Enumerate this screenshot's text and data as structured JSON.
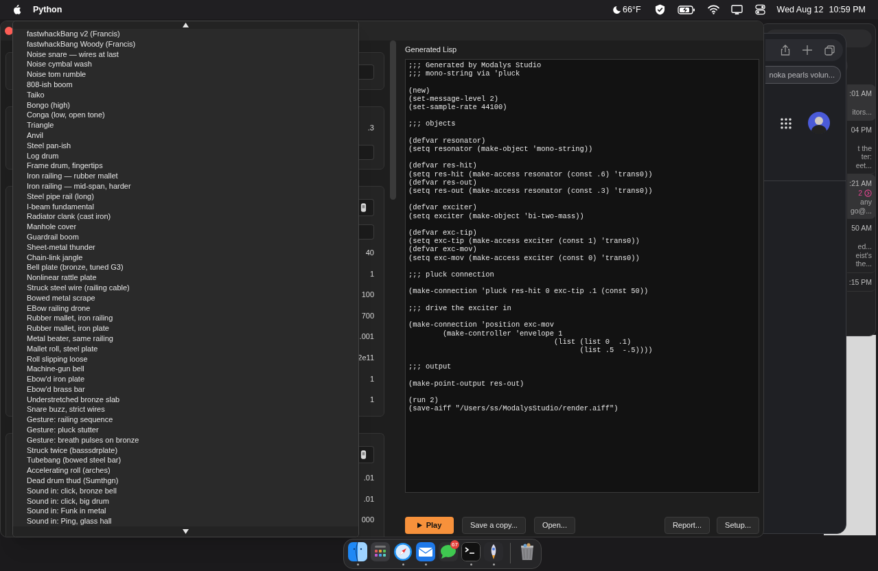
{
  "menu_bar": {
    "app_name": "Python",
    "weather": "66°F",
    "date": "Wed Aug 12",
    "time": "10:59 PM"
  },
  "preset_menu": {
    "items": [
      {
        "label": "fastwhackBang v2 (Francis)",
        "selected": false
      },
      {
        "label": "fastwhackBang Woody (Francis)",
        "selected": false
      },
      {
        "label": "Noise snare — wires at last",
        "selected": false
      },
      {
        "label": "Noise cymbal wash",
        "selected": false
      },
      {
        "label": "Noise tom rumble",
        "selected": false
      },
      {
        "label": "808-ish boom",
        "selected": false
      },
      {
        "label": "Taiko",
        "selected": false
      },
      {
        "label": "Bongo (high)",
        "selected": false
      },
      {
        "label": "Conga (low, open tone)",
        "selected": false
      },
      {
        "label": "Triangle",
        "selected": false
      },
      {
        "label": "Anvil",
        "selected": false
      },
      {
        "label": "Steel pan-ish",
        "selected": false
      },
      {
        "label": "Log drum",
        "selected": false
      },
      {
        "label": "Frame drum, fingertips",
        "selected": false
      },
      {
        "label": "Iron railing — rubber mallet",
        "selected": false
      },
      {
        "label": "Iron railing — mid-span, harder",
        "selected": false
      },
      {
        "label": "Steel pipe rail (long)",
        "selected": false
      },
      {
        "label": "I-beam fundamental",
        "selected": false
      },
      {
        "label": "Radiator clank (cast iron)",
        "selected": false
      },
      {
        "label": "Manhole cover",
        "selected": false
      },
      {
        "label": "Guardrail boom",
        "selected": false
      },
      {
        "label": "Sheet-metal thunder",
        "selected": false
      },
      {
        "label": "Chain-link jangle",
        "selected": false
      },
      {
        "label": "Bell plate (bronze, tuned G3)",
        "selected": false
      },
      {
        "label": "Nonlinear rattle plate",
        "selected": false
      },
      {
        "label": "Struck steel wire (railing cable)",
        "selected": false
      },
      {
        "label": "Bowed metal scrape",
        "selected": false
      },
      {
        "label": "EBow railing drone",
        "selected": false
      },
      {
        "label": "Rubber mallet, iron railing",
        "selected": false
      },
      {
        "label": "Rubber mallet, iron plate",
        "selected": false
      },
      {
        "label": "Metal beater, same railing",
        "selected": false
      },
      {
        "label": "Mallet roll, steel plate",
        "selected": false
      },
      {
        "label": "Roll slipping loose",
        "selected": false
      },
      {
        "label": "Machine-gun bell",
        "selected": false
      },
      {
        "label": "Ebow'd iron plate",
        "selected": false
      },
      {
        "label": "Ebow'd brass bar",
        "selected": false
      },
      {
        "label": "Understretched bronze slab",
        "selected": false
      },
      {
        "label": "Snare buzz, strict wires",
        "selected": false
      },
      {
        "label": "Gesture: railing sequence",
        "selected": false
      },
      {
        "label": "Gesture: pluck stutter",
        "selected": false
      },
      {
        "label": "Gesture: breath pulses on bronze",
        "selected": false
      },
      {
        "label": "Struck twice (basssdrplate)",
        "selected": false
      },
      {
        "label": "Tubebang (bowed steel bar)",
        "selected": false
      },
      {
        "label": "Accelerating roll (arches)",
        "selected": false
      },
      {
        "label": "Dead drum thud (Sumthgn)",
        "selected": false
      },
      {
        "label": "Sound in: click, bronze bell",
        "selected": false
      },
      {
        "label": "Sound in: click, big drum",
        "selected": false
      },
      {
        "label": "Sound in: Funk in metal",
        "selected": false
      },
      {
        "label": "Sound in: Ping, glass hall",
        "selected": false
      }
    ]
  },
  "parameter_panels": [
    {
      "rows": [
        {
          "kind": "field"
        }
      ]
    },
    {
      "rows": [
        {
          "kind": "value",
          "value": ".3"
        },
        {
          "kind": "field"
        }
      ]
    },
    {
      "rows": [
        {
          "kind": "icon_field"
        },
        {
          "kind": "field"
        },
        {
          "kind": "value",
          "value": "40"
        },
        {
          "kind": "value",
          "value": "1"
        },
        {
          "kind": "value",
          "value": "100"
        },
        {
          "kind": "value",
          "value": "700"
        },
        {
          "kind": "value",
          "value": ".001"
        },
        {
          "kind": "value",
          "value": "2e11"
        },
        {
          "kind": "value",
          "value": "1"
        },
        {
          "kind": "value",
          "value": "1"
        }
      ]
    },
    {
      "rows": [
        {
          "kind": "icon_field"
        },
        {
          "kind": "value",
          "value": ".01"
        },
        {
          "kind": "value",
          "value": ".01"
        },
        {
          "kind": "value",
          "value": "000"
        }
      ]
    }
  ],
  "lisp_panel": {
    "title": "Generated Lisp",
    "code": ";;; Generated by Modalys Studio\n;;; mono-string via 'pluck\n\n(new)\n(set-message-level 2)\n(set-sample-rate 44100)\n\n;;; objects\n\n(defvar resonator)\n(setq resonator (make-object 'mono-string))\n\n(defvar res-hit)\n(setq res-hit (make-access resonator (const .6) 'trans0))\n(defvar res-out)\n(setq res-out (make-access resonator (const .3) 'trans0))\n\n(defvar exciter)\n(setq exciter (make-object 'bi-two-mass))\n\n(defvar exc-tip)\n(setq exc-tip (make-access exciter (const 1) 'trans0))\n(defvar exc-mov)\n(setq exc-mov (make-access exciter (const 0) 'trans0))\n\n;;; pluck connection\n\n(make-connection 'pluck res-hit 0 exc-tip .1 (const 50))\n\n;;; drive the exciter in\n\n(make-connection 'position exc-mov\n        (make-controller 'envelope 1\n                                  (list (list 0  .1)\n                                        (list .5  -.5))))\n\n;;; output\n\n(make-point-output res-out)\n\n(run 2)\n(save-aiff \"/Users/ss/ModalysStudio/render.aiff\")"
  },
  "left_buttons": [
    {
      "label": "Play",
      "kind": "primary"
    },
    {
      "label": "Save a copy...",
      "kind": "secondary"
    },
    {
      "label": "Open...",
      "kind": "secondary"
    }
  ],
  "right_buttons": [
    {
      "label": "Report...",
      "kind": "secondary"
    },
    {
      "label": "Setup...",
      "kind": "secondary"
    }
  ],
  "browser_window": {
    "search_value": "noka pearls volun..."
  },
  "mail_window": {
    "items": [
      {
        "time": ":01 AM",
        "highlighted": true,
        "lines": [
          "itors..."
        ]
      },
      {
        "time": "04 PM",
        "highlighted": false,
        "lines": [
          "t the",
          "ter:",
          "eet..."
        ]
      },
      {
        "time": ":21 AM",
        "highlighted": true,
        "count": "2",
        "lines": [
          "any",
          "go@..."
        ]
      },
      {
        "time": "50 AM",
        "highlighted": false,
        "lines": [
          "ed...",
          "eist's",
          "the..."
        ]
      },
      {
        "time": ":15 PM",
        "highlighted": false
      }
    ]
  },
  "dock": {
    "apps": [
      {
        "kind": "finder",
        "running": true
      },
      {
        "kind": "launchpad",
        "running": false
      },
      {
        "kind": "safari",
        "running": true
      },
      {
        "kind": "mail",
        "running": true
      },
      {
        "kind": "messages",
        "running": false,
        "badge": "67"
      },
      {
        "kind": "terminal",
        "running": true
      },
      {
        "kind": "rocket",
        "running": true
      },
      {
        "kind": "trash",
        "running": false
      }
    ]
  }
}
